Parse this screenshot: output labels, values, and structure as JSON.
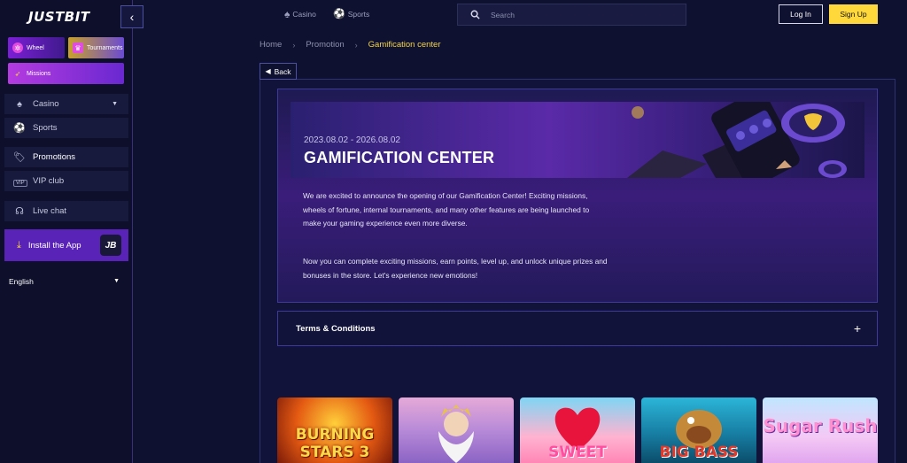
{
  "brand": {
    "logo_text": "JUSTBIT"
  },
  "sidebar": {
    "collapse_icon": "chevron-left-icon",
    "promo_tiles": [
      {
        "label": "Wheel",
        "icon": "wheel-icon"
      },
      {
        "label": "Tournaments",
        "icon": "trophy-icon"
      },
      {
        "label": "Missions",
        "icon": "rocket-icon"
      }
    ],
    "items": [
      {
        "label": "Casino",
        "icon": "spade-icon"
      },
      {
        "label": "Sports",
        "icon": "soccer-ball-icon"
      },
      {
        "label": "Promotions",
        "icon": "tag-icon"
      },
      {
        "label": "VIP club",
        "icon": "vip-icon",
        "badge": "VIP"
      },
      {
        "label": "Live chat",
        "icon": "headset-icon"
      }
    ],
    "install": {
      "label": "Install the App",
      "badge": "JB"
    },
    "language": "English"
  },
  "header": {
    "categories": [
      {
        "label": "Casino",
        "icon": "spade-icon"
      },
      {
        "label": "Sports",
        "icon": "soccer-ball-icon"
      }
    ],
    "search_placeholder": "Search",
    "login_label": "Log In",
    "signup_label": "Sign Up"
  },
  "breadcrumb": [
    "Home",
    "Promotion",
    "Gamification center"
  ],
  "back_label": "Back",
  "promotion": {
    "date_range": "2023.08.02 - 2026.08.02",
    "title": "GAMIFICATION CENTER",
    "paragraph_1": "We are excited to announce the opening of our Gamification Center! Exciting missions, wheels of fortune, internal tournaments, and many other features are being launched to make your gaming experience even more diverse.",
    "paragraph_2": "Now you can complete exciting missions, earn points, level up, and unlock unique prizes and bonuses in the store. Let's experience new emotions!"
  },
  "terms": {
    "label": "Terms & Conditions",
    "toggle": "+"
  },
  "games": [
    {
      "title": "BURNING STARS 3"
    },
    {
      "title": ""
    },
    {
      "title": "SWEET"
    },
    {
      "title": "BIG BASS"
    },
    {
      "title": "Sugar Rush"
    }
  ],
  "colors": {
    "accent_yellow": "#ffd83b",
    "accent_purple": "#5a23b8",
    "background": "#0f1130"
  }
}
